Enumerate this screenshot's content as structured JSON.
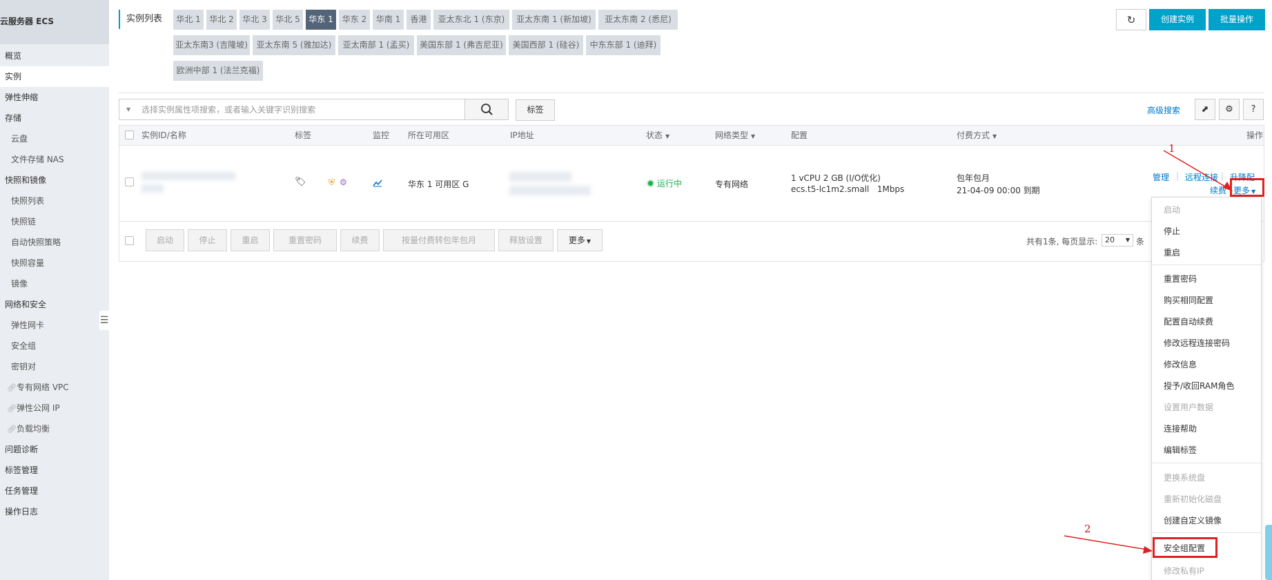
{
  "sidebar": {
    "title": "云服务器 ECS",
    "items": [
      {
        "label": "概览",
        "level": 1
      },
      {
        "label": "实例",
        "level": 1,
        "active": true
      },
      {
        "label": "弹性伸缩",
        "level": 1
      },
      {
        "label": "存储",
        "level": 1
      },
      {
        "label": "云盘",
        "level": 2
      },
      {
        "label": "文件存储 NAS",
        "level": 2
      },
      {
        "label": "快照和镜像",
        "level": 1
      },
      {
        "label": "快照列表",
        "level": 2
      },
      {
        "label": "快照链",
        "level": 2
      },
      {
        "label": "自动快照策略",
        "level": 2
      },
      {
        "label": "快照容量",
        "level": 2
      },
      {
        "label": "镜像",
        "level": 2
      },
      {
        "label": "网络和安全",
        "level": 1
      },
      {
        "label": "弹性网卡",
        "level": 2
      },
      {
        "label": "安全组",
        "level": 2
      },
      {
        "label": "密钥对",
        "level": 2
      },
      {
        "label": "专有网络 VPC",
        "level": 2,
        "link": true
      },
      {
        "label": "弹性公网 IP",
        "level": 2,
        "link": true
      },
      {
        "label": "负载均衡",
        "level": 2,
        "link": true
      },
      {
        "label": "问题诊断",
        "level": 1
      },
      {
        "label": "标签管理",
        "level": 1
      },
      {
        "label": "任务管理",
        "level": 1
      },
      {
        "label": "操作日志",
        "level": 1
      }
    ]
  },
  "header": {
    "list_title": "实例列表",
    "regions": [
      "华北 1",
      "华北 2",
      "华北 3",
      "华北 5",
      "华东 1",
      "华东 2",
      "华南 1",
      "香港",
      "亚太东北 1 (东京)",
      "亚太东南 1 (新加坡)",
      "亚太东南 2 (悉尼)",
      "亚太东南3 (吉隆坡)",
      "亚太东南 5 (雅加达)",
      "亚太南部 1 (孟买)",
      "美国东部 1 (弗吉尼亚)",
      "美国西部 1 (硅谷)",
      "中东东部 1 (迪拜)",
      "欧洲中部 1 (法兰克福)"
    ],
    "active_region": "华东 1",
    "refresh_icon": "refresh-icon",
    "create_label": "创建实例",
    "batch_label": "批量操作"
  },
  "search": {
    "placeholder": "选择实例属性项搜索，或者输入关键字识别搜索",
    "tag_label": "标签",
    "advanced_label": "高级搜索"
  },
  "table": {
    "columns": {
      "id_name": "实例ID/名称",
      "tags": "标签",
      "monitor": "监控",
      "zone": "所在可用区",
      "ip": "IP地址",
      "status": "状态",
      "network": "网络类型",
      "config": "配置",
      "billing": "付费方式",
      "actions": "操作"
    },
    "row": {
      "zone": "华东 1 可用区 G",
      "status": "运行中",
      "network": "专有网络",
      "config_line1": "1 vCPU 2 GB (I/O优化)",
      "config_line2": "ecs.t5-lc1m2.small   1Mbps",
      "billing_line1": "包年包月",
      "billing_line2": "21-04-09 00:00 到期",
      "action_manage": "管理",
      "action_remote": "远程连接",
      "action_upgrade": "升降配",
      "action_renew": "续费",
      "action_more": "更多"
    },
    "batch_buttons": [
      "启动",
      "停止",
      "重启",
      "重置密码",
      "续费",
      "按量付费转包年包月",
      "释放设置",
      "更多"
    ],
    "pagination": {
      "prefix": "共有1条, 每页显示:",
      "page_size": "20",
      "suffix": "条"
    }
  },
  "dropdown": {
    "items": [
      {
        "label": "启动",
        "disabled": true
      },
      {
        "label": "停止"
      },
      {
        "label": "重启"
      },
      {
        "label": "重置密码"
      },
      {
        "label": "购买相同配置"
      },
      {
        "label": "配置自动续费"
      },
      {
        "label": "修改远程连接密码"
      },
      {
        "label": "修改信息"
      },
      {
        "label": "授予/收回RAM角色"
      },
      {
        "label": "设置用户数据",
        "disabled": true
      },
      {
        "label": "连接帮助"
      },
      {
        "label": "编辑标签"
      },
      {
        "label": "更换系统盘",
        "disabled": true
      },
      {
        "label": "重新初始化磁盘",
        "disabled": true
      },
      {
        "label": "创建自定义镜像"
      },
      {
        "label": "安全组配置"
      },
      {
        "label": "修改私有IP",
        "disabled": true
      }
    ]
  },
  "annotations": {
    "step1": "1",
    "step2": "2"
  },
  "colors": {
    "accent": "#00a2ca",
    "active_tab": "#546478",
    "running": "#1db04a",
    "highlight": "#e02020",
    "link": "#0077cc"
  }
}
